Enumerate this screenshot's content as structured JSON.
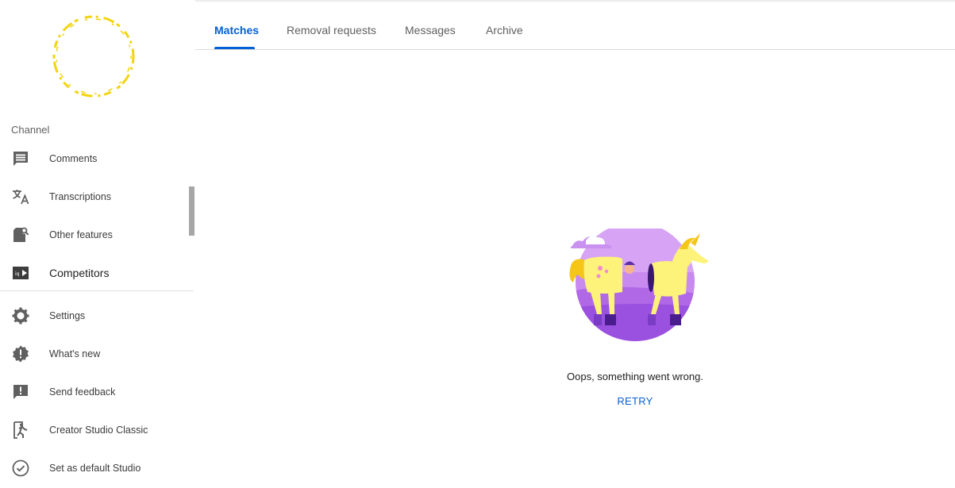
{
  "sidebar": {
    "section_label": "Channel",
    "items": [
      {
        "label": "Comments",
        "icon": "comment-icon"
      },
      {
        "label": "Transcriptions",
        "icon": "translate-icon"
      },
      {
        "label": "Other features",
        "icon": "other-features-icon"
      },
      {
        "label": "Competitors",
        "icon": "competitors-icon"
      },
      {
        "label": "Settings",
        "icon": "gear-icon"
      },
      {
        "label": "What's new",
        "icon": "whats-new-icon"
      },
      {
        "label": "Send feedback",
        "icon": "feedback-icon"
      },
      {
        "label": "Creator Studio Classic",
        "icon": "exit-icon"
      },
      {
        "label": "Set as default Studio",
        "icon": "check-circle-icon"
      }
    ]
  },
  "tabs": [
    {
      "label": "Matches",
      "active": true
    },
    {
      "label": "Removal requests",
      "active": false
    },
    {
      "label": "Messages",
      "active": false
    },
    {
      "label": "Archive",
      "active": false
    }
  ],
  "main": {
    "error_message": "Oops, something went wrong.",
    "retry_label": "RETRY",
    "illustration": "unicorn-costume-illustration"
  },
  "colors": {
    "accent": "#065fd4",
    "icon": "#606060",
    "avatar_ring": "#f2d40f"
  }
}
